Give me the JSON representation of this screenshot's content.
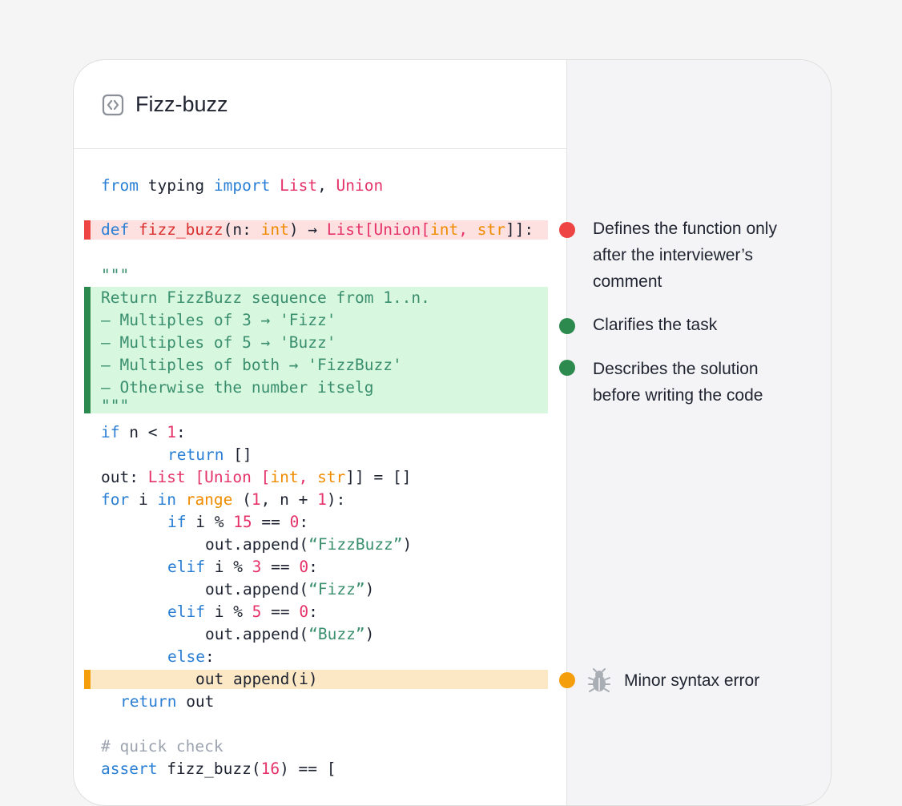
{
  "header": {
    "title": "Fizz-buzz",
    "icon": "code-file-icon"
  },
  "colors": {
    "keyword": "#2a7fd4",
    "type": "#e5336a",
    "type_alt": "#f08c00",
    "string": "#3a8f6e",
    "comment": "#9ca3af",
    "annotation_red": "#ef4444",
    "annotation_green": "#2d8a4e",
    "annotation_amber": "#f59e0b"
  },
  "code": {
    "l1": {
      "a": "from",
      "b": " typing ",
      "c": "import",
      "d": " ",
      "e": "List",
      "f": ", ",
      "g": "Union"
    },
    "l2": {
      "a": "def",
      "b": " ",
      "c": "fizz_buzz",
      "d": "(n: ",
      "e": "int",
      "f": ") → ",
      "g": "List",
      "h": "[",
      "i": "Union",
      "j": "[",
      "k": "int",
      "l": ", ",
      "m": "str",
      "n": "]]:"
    },
    "l3": "\"\"\"",
    "l4": "Return FizzBuzz sequence from 1..n.",
    "l5": "– Multiples of 3 → 'Fizz'",
    "l6": "– Multiples of 5 → 'Buzz'",
    "l7": "– Multiples of both → 'FizzBuzz'",
    "l8": "– Otherwise the number itselg",
    "l9": "\"\"\"",
    "l10": {
      "a": "if",
      "b": " n < ",
      "c": "1",
      "d": ":"
    },
    "l11": {
      "a": "return",
      "b": " []"
    },
    "l12": {
      "a": "out: ",
      "b": "List",
      "c": " [",
      "d": "Union",
      "e": " [",
      "f": "int",
      "g": ", ",
      "h": "str",
      "i": "]] = []"
    },
    "l13": {
      "a": "for",
      "b": " i ",
      "c": "in",
      "d": " ",
      "e": "range",
      "f": " (",
      "g": "1",
      "h": ", n + ",
      "i": "1",
      "j": "):"
    },
    "l14": {
      "a": "if",
      "b": " i % ",
      "c": "15",
      "d": " == ",
      "e": "0",
      "f": ":"
    },
    "l15": {
      "a": "out.append(",
      "b": "“FizzBuzz”",
      "c": ")"
    },
    "l16": {
      "a": "elif",
      "b": " i % ",
      "c": "3",
      "d": " == ",
      "e": "0",
      "f": ":"
    },
    "l17": {
      "a": "out.append(",
      "b": "“Fizz”",
      "c": ")"
    },
    "l18": {
      "a": "elif",
      "b": " i % ",
      "c": "5",
      "d": " == ",
      "e": "0",
      "f": ":"
    },
    "l19": {
      "a": "out.append(",
      "b": "“Buzz”",
      "c": ")"
    },
    "l20": {
      "a": "else",
      "b": ":"
    },
    "l21": "out append(i)",
    "l22": {
      "a": "return",
      "b": " out"
    },
    "l23": "# quick check",
    "l24": {
      "a": "assert",
      "b": " fizz_buzz(",
      "c": "16",
      "d": ") == ["
    }
  },
  "annotations": [
    {
      "text": "Defines the function only after the interviewer’s comment",
      "line1": "Defines the function only",
      "line2": "after the interviewer’s",
      "line3": "comment",
      "status": "red"
    },
    {
      "text": "Clarifies the task",
      "status": "green"
    },
    {
      "text": "Describes the solution before writing the code",
      "line1": "Describes the solution",
      "line2": "before writing the code",
      "status": "green"
    },
    {
      "text": "Minor syntax error",
      "status": "amber",
      "icon": "bug-icon"
    }
  ]
}
